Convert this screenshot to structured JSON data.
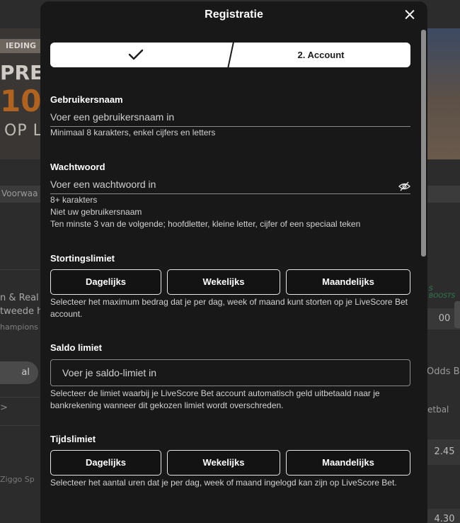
{
  "background": {
    "badge": "IEDING",
    "promo_line1": "PRE-",
    "promo_amount": "10",
    "promo_line3": "OP L",
    "conditions_link": "Voorwaa",
    "match_line1": "n & Real",
    "match_line2": "tweede h",
    "competition": "hampions",
    "filter_pill": "al",
    "boosts_label": "S BOOSTS",
    "odd_top": "00",
    "odds_tab": "Odds B",
    "nav_arrow": ">",
    "sport_label": "etbal",
    "broadcaster": "Ziggo Sp",
    "odd_mid": "2.45",
    "odd_bottom": "4.30"
  },
  "modal": {
    "title": "Registratie",
    "stepper": {
      "step1_icon": "check-icon",
      "step2_label": "2. Account"
    },
    "username": {
      "label": "Gebruikersnaam",
      "placeholder": "Voer een gebruikersnaam in",
      "hint": "Minimaal 8 karakters, enkel cijfers en letters"
    },
    "password": {
      "label": "Wachtwoord",
      "placeholder": "Voer een wachtwoord in",
      "toggle_icon": "eye-slash-icon",
      "hints": [
        "8+ karakters",
        "Niet uw gebruikersnaam",
        "Ten minste 3 van de volgende; hoofdletter, kleine letter, cijfer of een speciaal teken"
      ]
    },
    "deposit_limit": {
      "label": "Stortingslimiet",
      "options": [
        "Dagelijks",
        "Wekelijks",
        "Maandelijks"
      ],
      "hint": "Selecteer het maximum bedrag dat je per dag, week of maand kunt storten op je LiveScore Bet account."
    },
    "balance_limit": {
      "label": "Saldo limiet",
      "placeholder": "Voer je saldo-limiet in",
      "hint": "Selecteer de limiet waarbij je LiveScore Bet account automatisch geld uitbetaald naar je bankrekening wanneer dit gekozen limiet wordt overschreden."
    },
    "time_limit": {
      "label": "Tijdslimiet",
      "options": [
        "Dagelijks",
        "Wekelijks",
        "Maandelijks"
      ],
      "hint": "Selecteer het aantal uren dat je per dag, week of maand ingelogd kan zijn op LiveScore Bet."
    }
  }
}
